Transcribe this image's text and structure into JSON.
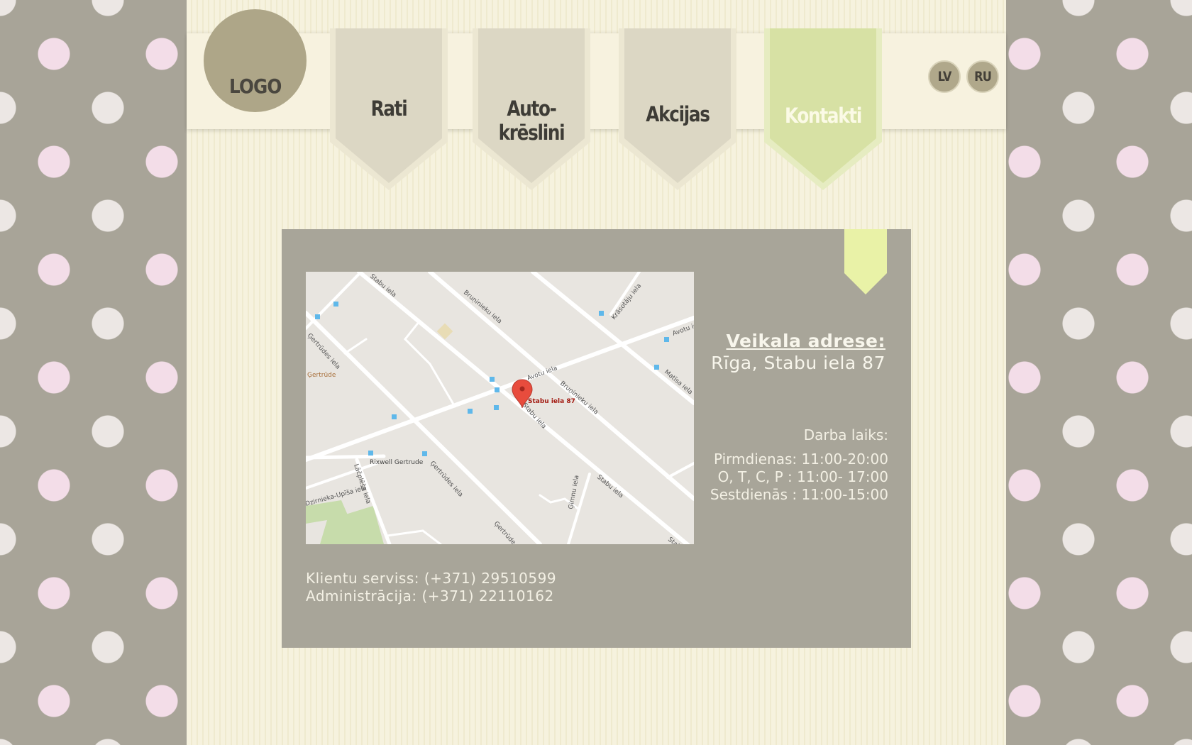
{
  "header": {
    "logo_text": "LOGO",
    "nav": [
      {
        "label": "Rati",
        "active": false
      },
      {
        "label": "Auto-krēslini",
        "active": false
      },
      {
        "label": "Akcijas",
        "active": false
      },
      {
        "label": "Kontakti",
        "active": true
      }
    ],
    "languages": [
      "LV",
      "RU"
    ]
  },
  "contact": {
    "address_title": "Veikala adrese:",
    "address": "Rīga, Stabu iela 87",
    "hours_title": "Darba laiks:",
    "hours": [
      "Pirmdienas: 11:00-20:00",
      "O, T, C, P : 11:00- 17:00",
      "Sestdienās : 11:00-15:00"
    ],
    "phones": [
      "Klientu serviss: (+371) 29510599",
      "Administrācija: (+371) 22110162"
    ]
  },
  "map": {
    "marker_label": "Stabu iela 87",
    "streets": [
      "Stabu iela",
      "Bruņinieku iela",
      "Krāsotāju iela",
      "Avotu iela",
      "Matīsa iela",
      "Ģertrūdes iela",
      "Lāčplēša iela",
      "Ģertrūde",
      "Rixwell Gertrude",
      "Stabu iela",
      "Bruņinieku iela",
      "Avotu iela",
      "Stabu iela",
      "Ģertrūdes iela",
      "Ģertrūde",
      "Dzirnieka-Upīša iela",
      "Ģimnu iela",
      "Stabu iela"
    ]
  },
  "colors": {
    "nav_tab": "#dcd7c4",
    "nav_tab_active": "#d7e1a4",
    "content_bg": "#a8a599",
    "ribbon": "#e9f2a7"
  }
}
